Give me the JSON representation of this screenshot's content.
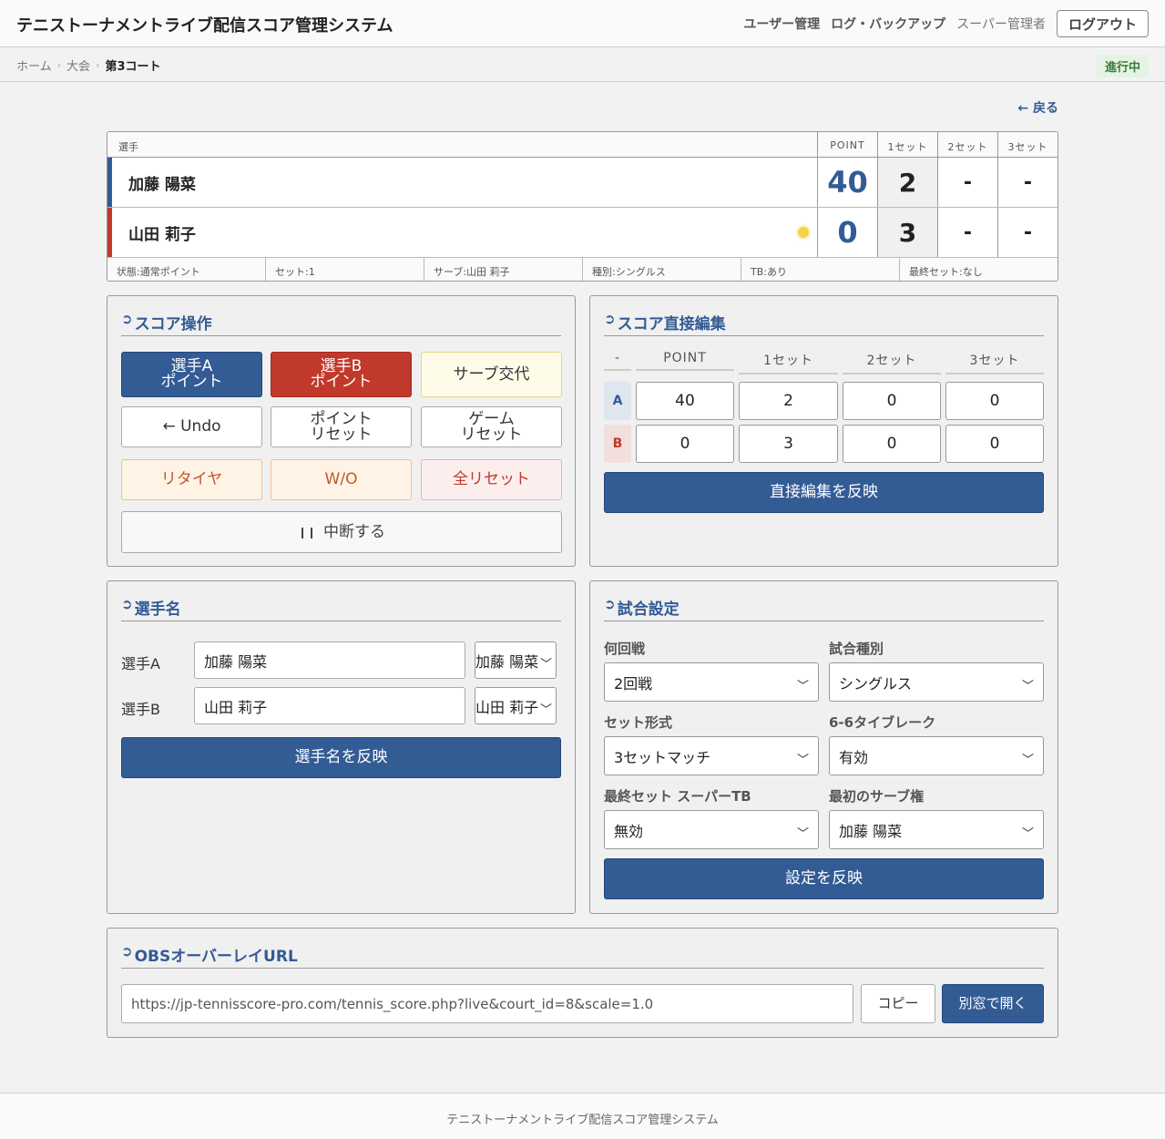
{
  "header": {
    "title": "テニストーナメントライブ配信スコア管理システム",
    "nav": [
      "ユーザー管理",
      "ログ・バックアップ"
    ],
    "role": "スーパー管理者",
    "logout_label": "ログアウト"
  },
  "breadcrumb": {
    "items": [
      "ホーム",
      "大会",
      "第3コート"
    ],
    "status": "進行中"
  },
  "back_label": "← 戻る",
  "scoreboard": {
    "columns": {
      "player": "選手",
      "point": "POINT",
      "set1": "1セット",
      "set2": "2セット",
      "set3": "3セット"
    },
    "rows": [
      {
        "name": "加藤 陽菜",
        "point": "40",
        "set1": "2",
        "set2": "-",
        "set3": "-"
      },
      {
        "name": "山田 莉子",
        "point": "0",
        "set1": "3",
        "set2": "-",
        "set3": "-"
      }
    ],
    "footer": [
      "状態:通常ポイント",
      "セット:1",
      "サーブ:山田 莉子",
      "種別:シングルス",
      "TB:あり",
      "最終セット:なし"
    ]
  },
  "score_ops": {
    "title": "スコア操作",
    "point_a": [
      "選手A",
      "ポイント"
    ],
    "point_b": [
      "選手B",
      "ポイント"
    ],
    "serve_change": "サーブ交代",
    "undo": "← Undo",
    "point_reset": [
      "ポイント",
      "リセット"
    ],
    "game_reset": [
      "ゲーム",
      "リセット"
    ],
    "retire": "リタイヤ",
    "walkover": "W/O",
    "all_reset": "全リセット",
    "suspend": "中断する"
  },
  "direct_edit": {
    "title": "スコア直接編集",
    "headers": [
      "-",
      "POINT",
      "1セット",
      "2セット",
      "3セット"
    ],
    "row_a": {
      "tag": "A",
      "values": [
        "40",
        "2",
        "0",
        "0"
      ]
    },
    "row_b": {
      "tag": "B",
      "values": [
        "0",
        "3",
        "0",
        "0"
      ]
    },
    "apply_label": "直接編集を反映"
  },
  "player_names": {
    "title": "選手名",
    "label_a": "選手A",
    "label_b": "選手B",
    "value_a": "加藤 陽菜",
    "value_b": "山田 莉子",
    "select_a": "加藤 陽菜",
    "select_b": "山田 莉子",
    "apply_label": "選手名を反映"
  },
  "match_settings": {
    "title": "試合設定",
    "round_label": "何回戦",
    "round_value": "2回戦",
    "type_label": "試合種別",
    "type_value": "シングルス",
    "format_label": "セット形式",
    "format_value": "3セットマッチ",
    "tb_label": "6-6タイブレーク",
    "tb_value": "有効",
    "final_tb_label": "最終セット スーパーTB",
    "final_tb_value": "無効",
    "first_serve_label": "最初のサーブ権",
    "first_serve_value": "加藤 陽菜",
    "apply_label": "設定を反映"
  },
  "obs": {
    "title": "OBSオーバーレイURL",
    "url": "https://jp-tennisscore-pro.com/tennis_score.php?live&court_id=8&scale=1.0",
    "copy_label": "コピー",
    "open_label": "別窓で開く"
  },
  "footer_text": "テニストーナメントライブ配信スコア管理システム",
  "colors": {
    "primary": "#335b94",
    "danger": "#c0392b",
    "serve_dot": "#f5d24b",
    "status_bg": "#e4f3e4"
  }
}
